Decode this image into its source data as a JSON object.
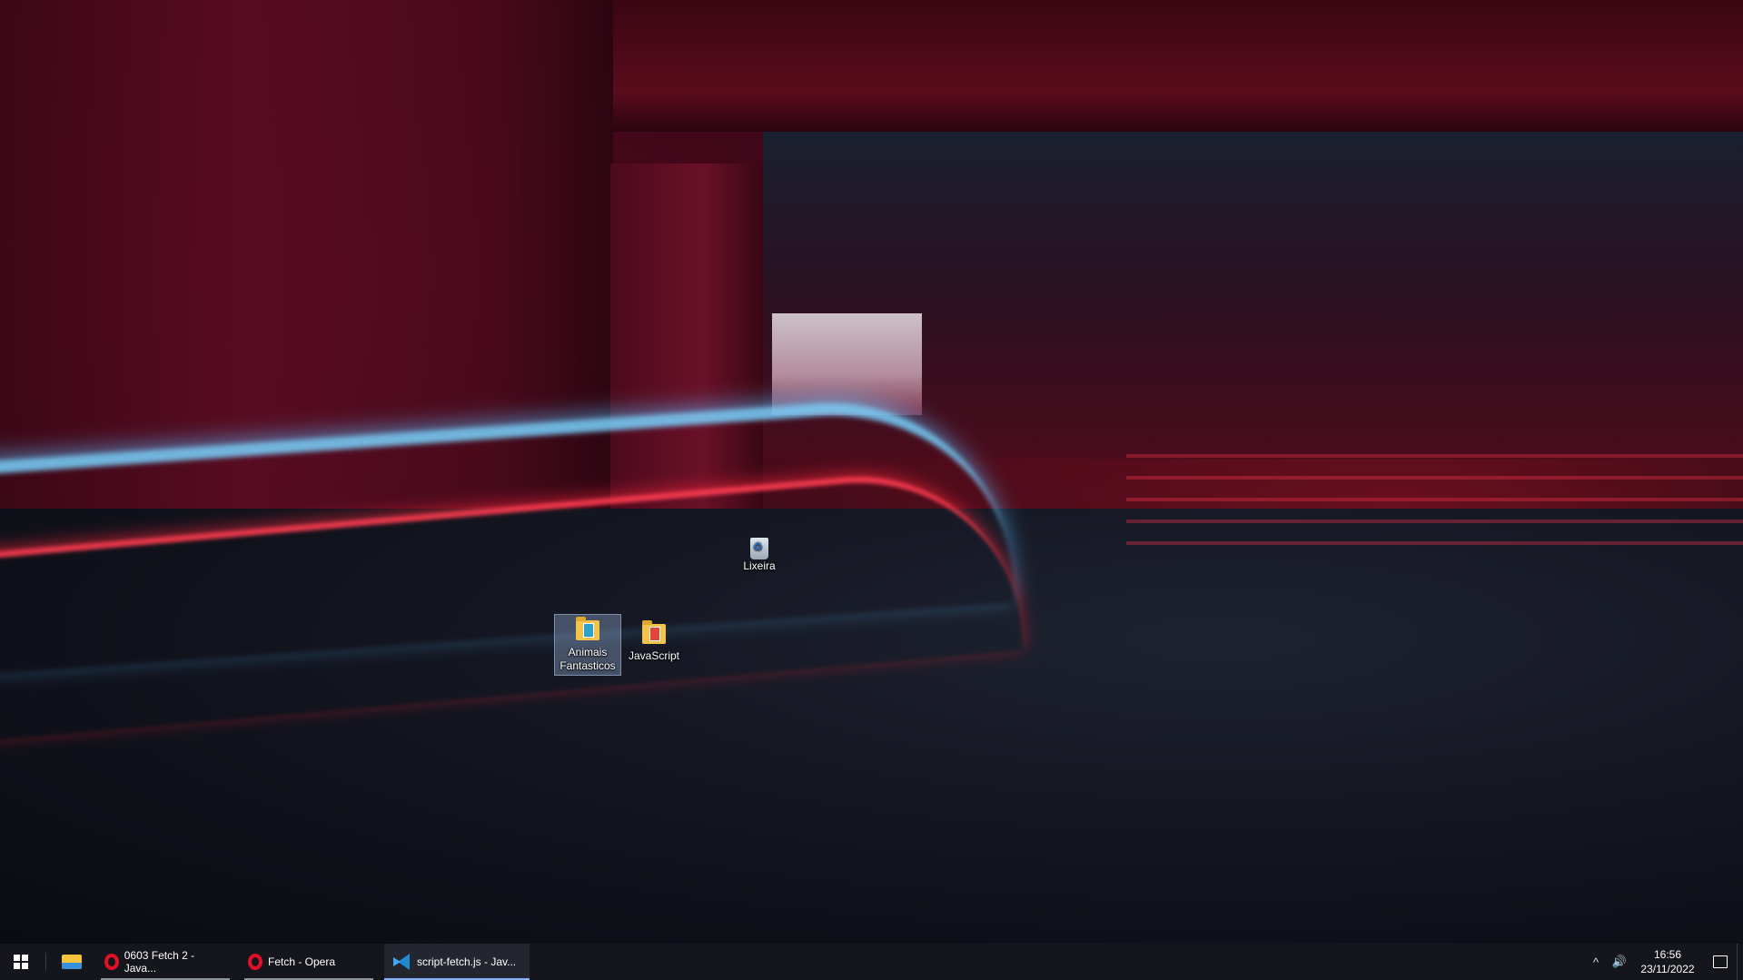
{
  "desktop": {
    "icons": [
      {
        "label": "Lixeira",
        "icon": "recycle-bin-icon",
        "selected": false
      },
      {
        "label": "Animais Fantasticos",
        "icon": "folder-icon",
        "selected": true
      },
      {
        "label": "JavaScript",
        "icon": "folder-icon",
        "selected": false
      }
    ]
  },
  "taskbar": {
    "start_icon": "windows-logo-icon",
    "pinned": [
      {
        "name": "file-explorer",
        "icon": "file-explorer-icon"
      }
    ],
    "apps": [
      {
        "label": "0603 Fetch 2 - Java...",
        "icon": "opera-icon",
        "active": false
      },
      {
        "label": "Fetch - Opera",
        "icon": "opera-icon",
        "active": false
      },
      {
        "label": "script-fetch.js - Jav...",
        "icon": "vscode-icon",
        "active": true
      }
    ],
    "tray": {
      "chevron": "^",
      "volume_icon": "speaker-icon",
      "time": "16:56",
      "date": "23/11/2022",
      "notification_icon": "action-center-icon"
    },
    "accent_color": "#7fb3ff"
  }
}
